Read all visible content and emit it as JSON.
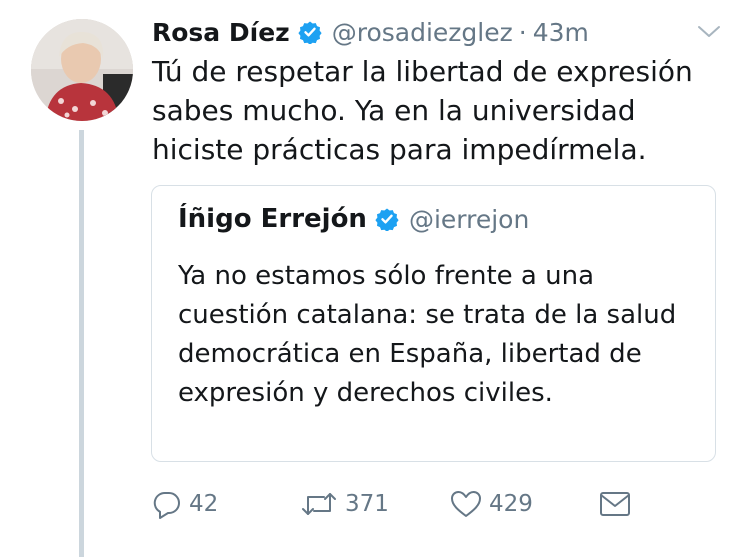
{
  "tweet": {
    "author_name": "Rosa Díez",
    "handle": "@rosadiezglez",
    "separator": "·",
    "time": "43m",
    "text": "Tú de respetar la libertad de expresión sabes mucho. Ya en la universidad hiciste prácticas para impedírmela."
  },
  "quoted_tweet": {
    "author_name": "Íñigo Errejón",
    "handle": "@ierrejon",
    "text": "Ya no estamos sólo frente a una cuestión catalana: se trata de la salud democrática en España, libertad de expresión y derechos civiles."
  },
  "actions": {
    "replies": "42",
    "retweets": "371",
    "likes": "429"
  },
  "colors": {
    "verified": "#1da1f2",
    "secondary_text": "#657786",
    "thread_line": "#ccd6dd"
  }
}
